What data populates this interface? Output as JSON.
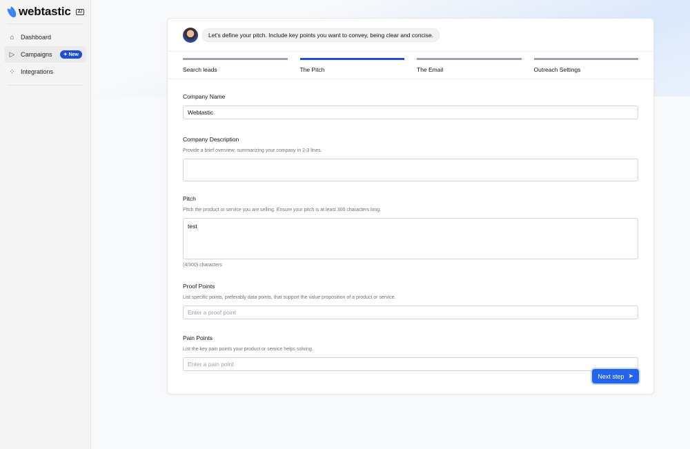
{
  "brand": {
    "name": "webtastic",
    "tag": "AI"
  },
  "nav": [
    {
      "label": "Dashboard"
    },
    {
      "label": "Campaigns",
      "badge": "New"
    },
    {
      "label": "Integrations"
    }
  ],
  "assistant": {
    "message": "Let's define your pitch. Include key points you want to convey, being clear and concise."
  },
  "steps": [
    {
      "label": "Search leads"
    },
    {
      "label": "The Pitch"
    },
    {
      "label": "The Email"
    },
    {
      "label": "Outreach Settings"
    }
  ],
  "form": {
    "company_name": {
      "label": "Company Name",
      "value": "Webtastic"
    },
    "company_description": {
      "label": "Company Description",
      "help": "Provide a brief overview, summarizing your company in 2-3 lines.",
      "value": ""
    },
    "pitch": {
      "label": "Pitch",
      "help": "Pitch the product or service you are selling. Ensure your pitch is at least 300 characters long.",
      "value": "test",
      "counter": "(4/300) characters"
    },
    "proof_points": {
      "label": "Proof Points",
      "help": "List specific points, preferably data points, that support the value proposition of a product or service.",
      "placeholder": "Enter a proof point"
    },
    "pain_points": {
      "label": "Pain Points",
      "help": "List the key pain points your product or service helps solving.",
      "placeholder": "Enter a pain point"
    }
  },
  "next_label": "Next step"
}
